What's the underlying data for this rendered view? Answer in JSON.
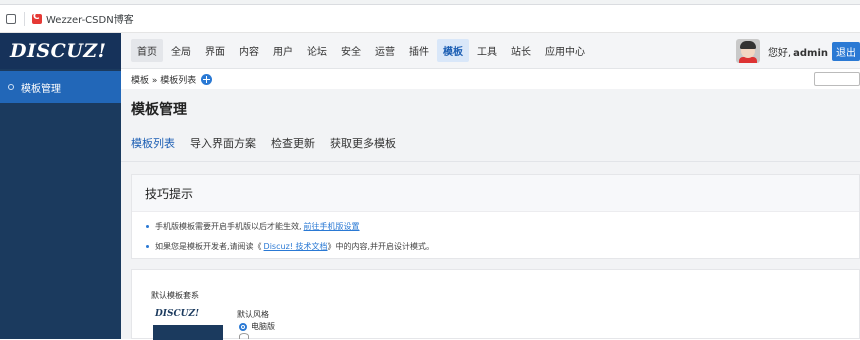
{
  "browser": {
    "bookmark_label": "Wezzer-CSDN博客"
  },
  "sidebar": {
    "logo": "DISCUZ!",
    "items": [
      {
        "label": "模板管理"
      }
    ]
  },
  "topnav": {
    "items": [
      {
        "label": "首页"
      },
      {
        "label": "全局"
      },
      {
        "label": "界面"
      },
      {
        "label": "内容"
      },
      {
        "label": "用户"
      },
      {
        "label": "论坛"
      },
      {
        "label": "安全"
      },
      {
        "label": "运营"
      },
      {
        "label": "插件"
      },
      {
        "label": "模板"
      },
      {
        "label": "工具"
      },
      {
        "label": "站长"
      },
      {
        "label": "应用中心"
      }
    ],
    "greeting": "您好,",
    "username": "admin",
    "logout": "退出"
  },
  "breadcrumb": {
    "text": "模板 » 模板列表"
  },
  "page": {
    "title": "模板管理",
    "tabs": [
      {
        "label": "模板列表"
      },
      {
        "label": "导入界面方案"
      },
      {
        "label": "检查更新"
      },
      {
        "label": "获取更多模板"
      }
    ],
    "tips": {
      "heading": "技巧提示",
      "tip1": "手机版模板需要开启手机版以后才能生效,",
      "tip1_link": "前往手机版设置",
      "tip2": "如果您是模板开发者,请阅读《",
      "tip2_link": "Discuz! 技术文档",
      "tip2_end": "》中的内容,并开启设计模式。"
    },
    "template": {
      "heading": "默认模板套系",
      "thumb_logo": "DISCUZ!",
      "style_label": "默认风格",
      "radio_label": "电脑版"
    }
  }
}
